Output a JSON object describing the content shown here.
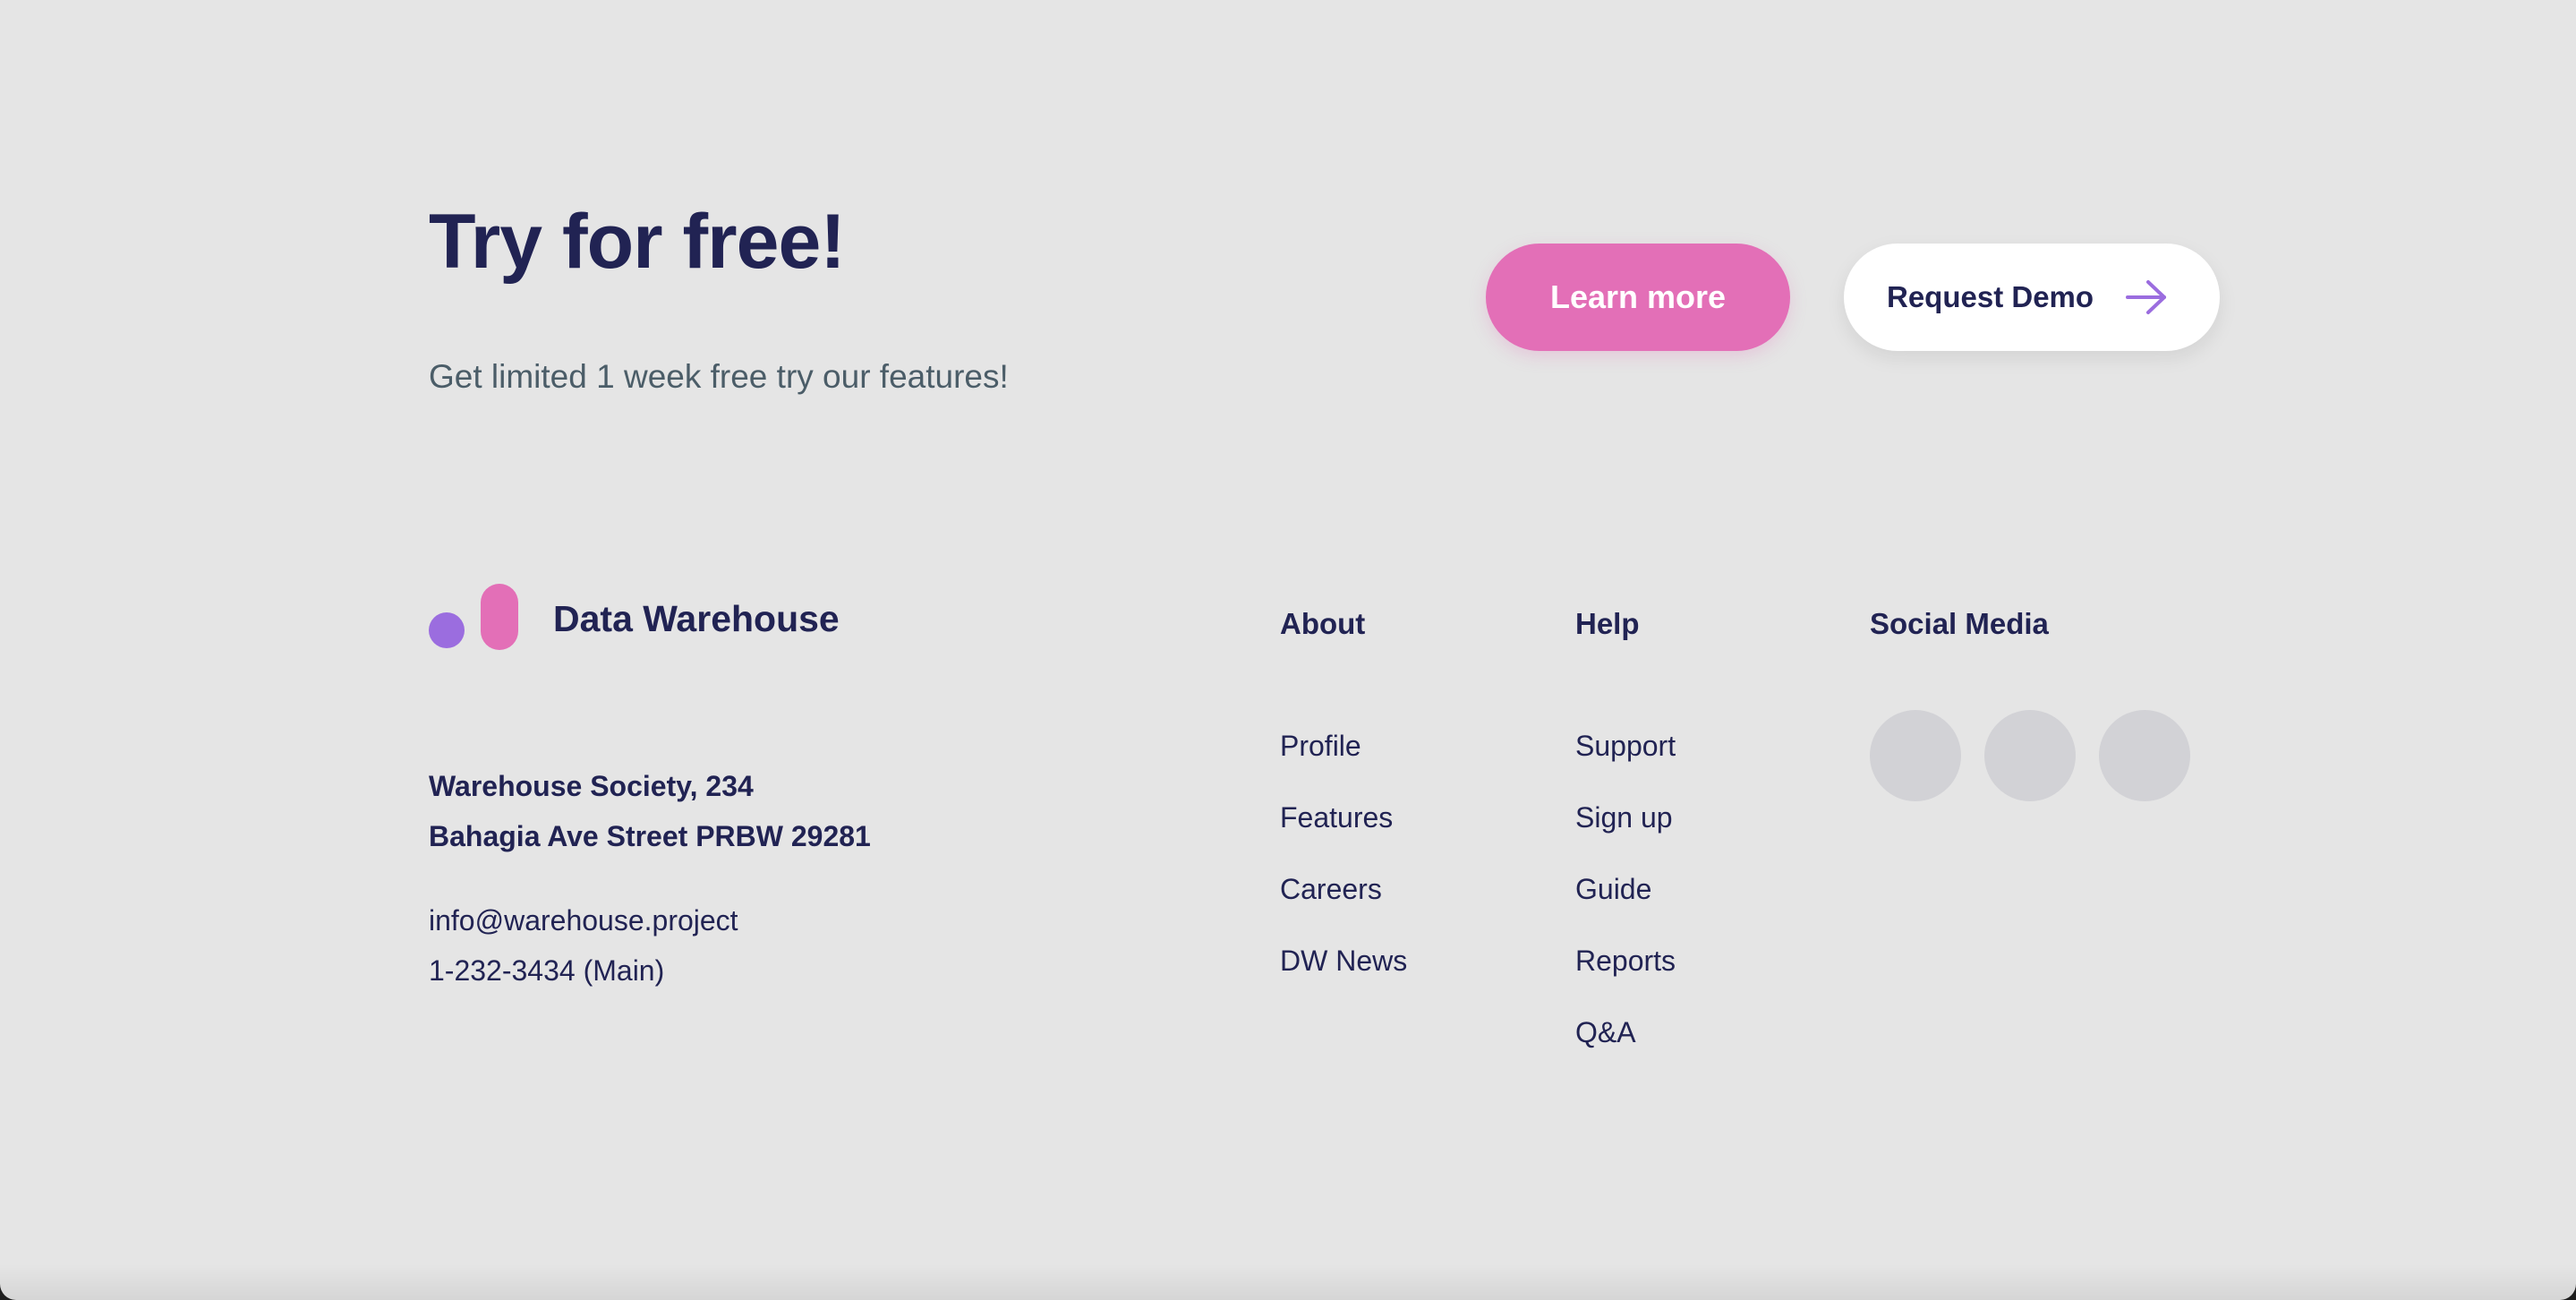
{
  "cta": {
    "title": "Try for free!",
    "subtitle": "Get limited 1 week free try our features!",
    "learn_more_label": "Learn more",
    "request_demo_label": "Request Demo"
  },
  "brand": {
    "name": "Data Warehouse",
    "address_line1": "Warehouse Society, 234",
    "address_line2": "Bahagia Ave Street PRBW 29281",
    "email": "info@warehouse.project",
    "phone": "1-232-3434 (Main)"
  },
  "footer": {
    "about": {
      "heading": "About",
      "links": [
        "Profile",
        "Features",
        "Careers",
        "DW News"
      ]
    },
    "help": {
      "heading": "Help",
      "links": [
        "Support",
        "Sign up",
        "Guide",
        "Reports",
        "Q&A"
      ]
    },
    "social": {
      "heading": "Social Media",
      "icons": [
        "social-icon-1",
        "social-icon-2",
        "social-icon-3"
      ]
    }
  },
  "colors": {
    "background": "#e5e5e5",
    "navy": "#212353",
    "pink": "#e36fb7",
    "purple": "#9b6ddf",
    "social_placeholder": "#d2d2d6"
  }
}
